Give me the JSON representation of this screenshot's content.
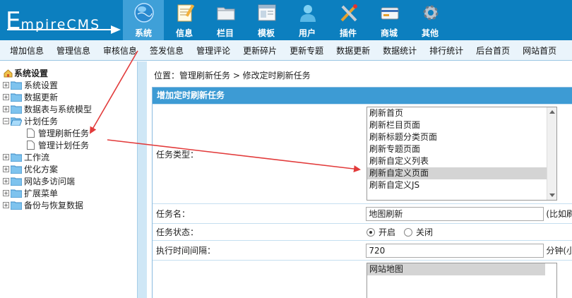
{
  "header": {
    "logo": "EmpireCMS",
    "nav": [
      {
        "label": "系统",
        "icon": "globe-icon",
        "active": true
      },
      {
        "label": "信息",
        "icon": "notepad-icon",
        "active": false
      },
      {
        "label": "栏目",
        "icon": "folder-icon",
        "active": false
      },
      {
        "label": "模板",
        "icon": "template-window-icon",
        "active": false
      },
      {
        "label": "用户",
        "icon": "user-icon",
        "active": false
      },
      {
        "label": "插件",
        "icon": "tools-icon",
        "active": false
      },
      {
        "label": "商城",
        "icon": "card-icon",
        "active": false
      },
      {
        "label": "其他",
        "icon": "gear-icon",
        "active": false
      }
    ]
  },
  "menubar": [
    "增加信息",
    "管理信息",
    "审核信息",
    "签发信息",
    "管理评论",
    "更新碎片",
    "更新专题",
    "数据更新",
    "数据统计",
    "排行统计",
    "后台首页",
    "网站首页"
  ],
  "sidebar": {
    "root": "系统设置",
    "items": [
      {
        "label": "系统设置",
        "expanded": false
      },
      {
        "label": "数据更新",
        "expanded": false
      },
      {
        "label": "数据表与系统模型",
        "expanded": false
      },
      {
        "label": "计划任务",
        "expanded": true,
        "children": [
          "管理刷新任务",
          "管理计划任务"
        ]
      },
      {
        "label": "工作流",
        "expanded": false
      },
      {
        "label": "优化方案",
        "expanded": false
      },
      {
        "label": "网站多访问端",
        "expanded": false
      },
      {
        "label": "扩展菜单",
        "expanded": false
      },
      {
        "label": "备份与恢复数据",
        "expanded": false
      }
    ]
  },
  "main": {
    "breadcrumb": "位置：管理刷新任务 > 修改定时刷新任务",
    "form_title": "增加定时刷新任务",
    "task_type": {
      "label": "任务类型：",
      "options": [
        "刷新首页",
        "刷新栏目页面",
        "刷新标题分类页面",
        "刷新专题页面",
        "刷新自定义列表",
        "刷新自定义页面",
        "刷新自定义JS"
      ],
      "selected": "刷新自定义页面"
    },
    "task_name": {
      "label": "任务名：",
      "value": "地图刷新",
      "hint": "(比如刷"
    },
    "task_status": {
      "label": "任务状态：",
      "on": "开启",
      "off": "关闭"
    },
    "interval": {
      "label": "执行时间间隔：",
      "value": "720",
      "hint": "分钟(小"
    },
    "page_list": [
      "网站地图"
    ]
  },
  "colors": {
    "header": "#0c7fbf",
    "active_tab": "#3fa0d8",
    "form_title": "#3d9bd4",
    "annotation_arrow": "#e23b3b"
  }
}
